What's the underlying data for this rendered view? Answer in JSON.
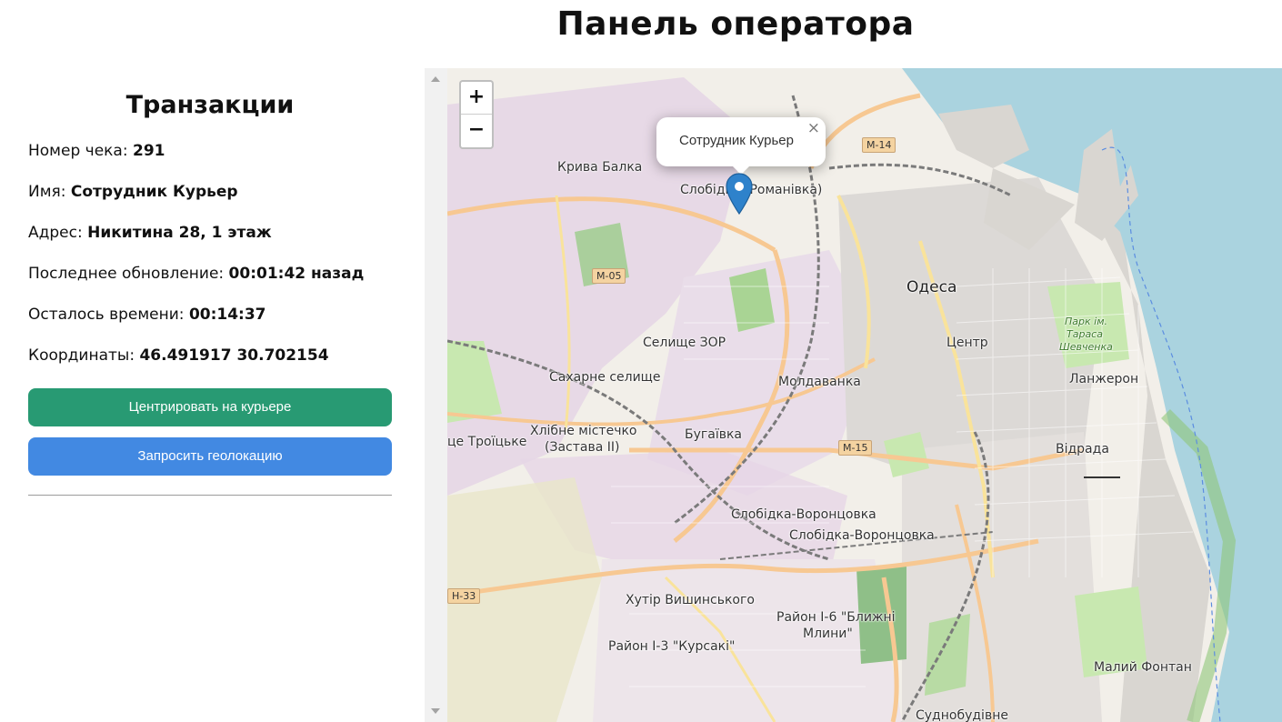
{
  "page": {
    "title": "Панель оператора"
  },
  "panel": {
    "title": "Транзакции",
    "rows": [
      {
        "label": "Номер чека: ",
        "value": "291"
      },
      {
        "label": "Имя: ",
        "value": "Сотрудник Курьер"
      },
      {
        "label": "Адрес: ",
        "value": "Никитина 28, 1 этаж"
      },
      {
        "label": "Последнее обновление: ",
        "value": "00:01:42 назад"
      },
      {
        "label": "Осталось времени: ",
        "value": "00:14:37"
      },
      {
        "label": "Координаты: ",
        "value": "46.491917 30.702154"
      }
    ],
    "center_button": "Центрировать на курьере",
    "geo_button": "Запросить геолокацию"
  },
  "map": {
    "zoom_in": "+",
    "zoom_out": "−",
    "popup_text": "Сотрудник Курьер",
    "popup_close": "×",
    "labels": {
      "kryva_balka": "Крива Балка",
      "slobidka": "Слобідка (Романівка)",
      "odesa": "Одеса",
      "tsentr": "Центр",
      "selyshche_zor": "Селище ЗОР",
      "sakharne": "Сахарне селище",
      "moldavanka": "Молдаванка",
      "langeron": "Ланжерон",
      "buhaivka": "Бугаївка",
      "khlibne": "Хлібне містечко",
      "zastava": "(Застава II)",
      "troitske": "це Троїцьке",
      "vidrada": "Відрада",
      "slobidka_vor_1": "Слобідка-Воронцовка",
      "slobidka_vor_2": "Слобідка-Воронцовка",
      "khutir": "Хутір Вишинського",
      "raion_i6_1": "Район І-6 \"Ближні",
      "raion_i6_2": "Млини\"",
      "raion_i3": "Район І-3 \"Курсакі\"",
      "malyi_fontan": "Малий Фонтан",
      "sudnobudivne": "Суднобудівне",
      "park_1": "Парк ім.",
      "park_2": "Тараса",
      "park_3": "Шевченка"
    },
    "shields": {
      "m14": "М-14",
      "m05": "М-05",
      "m15": "М-15",
      "h33": "Н-33"
    },
    "colors": {
      "water": "#aad3df",
      "land": "#f2efe9",
      "residential": "#e6d6e6",
      "park": "#c8e8b0",
      "major_road": "#f7c892",
      "rail": "#7a7a7a"
    }
  }
}
